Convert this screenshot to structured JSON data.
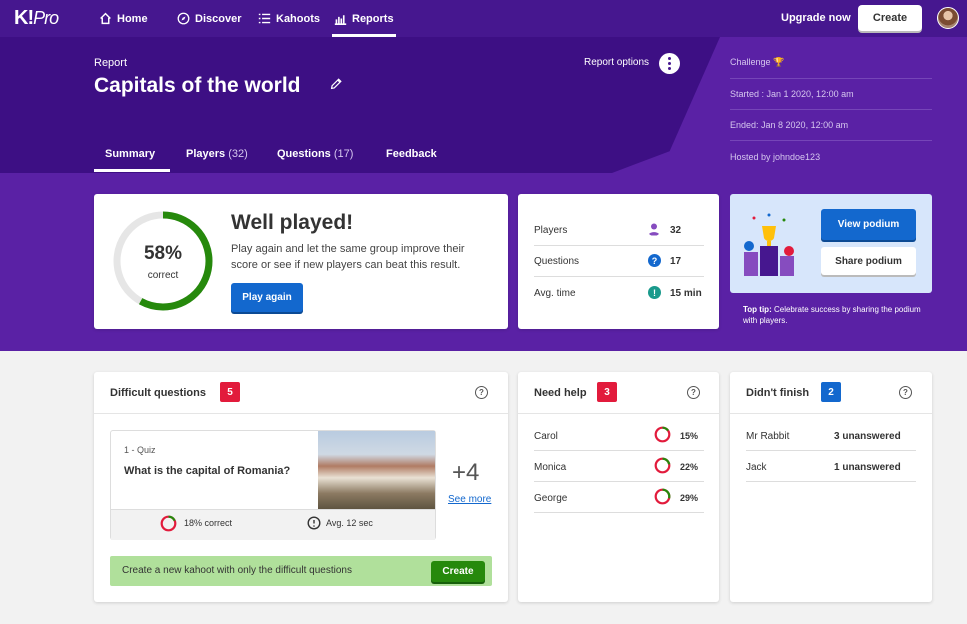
{
  "nav": {
    "logo": "K!",
    "logo_suffix": "Pro",
    "items": [
      {
        "label": "Home",
        "icon": "home-icon"
      },
      {
        "label": "Discover",
        "icon": "compass-icon"
      },
      {
        "label": "Kahoots",
        "icon": "list-icon"
      },
      {
        "label": "Reports",
        "icon": "bar-chart-icon",
        "active": true
      }
    ],
    "upgrade": "Upgrade now",
    "create": "Create"
  },
  "header": {
    "label": "Report",
    "title": "Capitals of the world",
    "options_label": "Report options",
    "tabs": [
      {
        "label": "Summary",
        "count": ""
      },
      {
        "label": "Players",
        "count": "(32)"
      },
      {
        "label": "Questions",
        "count": "(17)"
      },
      {
        "label": "Feedback",
        "count": ""
      }
    ]
  },
  "info": {
    "type": "Challenge",
    "started": "Started : Jan 1 2020, 12:00 am",
    "ended": "Ended: Jan 8 2020, 12:00 am",
    "hosted": "Hosted by johndoe123"
  },
  "summary": {
    "percent": "58%",
    "percent_value": 0.58,
    "percent_label": "correct",
    "title": "Well played!",
    "text": "Play again and let the same group improve their score or see if new players can beat this result.",
    "play_again": "Play again"
  },
  "stats": [
    {
      "label": "Players",
      "value": "32",
      "color": "#864cbf",
      "icon": "user-icon"
    },
    {
      "label": "Questions",
      "value": "17",
      "color": "#1368ce",
      "icon": "question-icon"
    },
    {
      "label": "Avg. time",
      "value": "15 min",
      "color": "#26890c",
      "icon": "clock-icon"
    }
  ],
  "podium": {
    "view": "View podium",
    "share": "Share podium",
    "tip_strong": "Top tip:",
    "tip": "Celebrate success by sharing the podium with players."
  },
  "difficult": {
    "title": "Difficult questions",
    "count": "5",
    "quiz_label": "1 - Quiz",
    "question": "What is the capital of Romania?",
    "more_count": "+4",
    "see_more": "See more",
    "correct": "18% correct",
    "correct_value": 0.18,
    "avg": "Avg. 12 sec",
    "banner": "Create a new kahoot with only the difficult questions",
    "banner_button": "Create"
  },
  "need_help": {
    "title": "Need help",
    "count": "3",
    "people": [
      {
        "name": "Carol",
        "value": "15%",
        "fraction": 0.15
      },
      {
        "name": "Monica",
        "value": "22%",
        "fraction": 0.22
      },
      {
        "name": "George",
        "value": "29%",
        "fraction": 0.29
      }
    ]
  },
  "didnt_finish": {
    "title": "Didn't finish",
    "count": "2",
    "people": [
      {
        "name": "Mr Rabbit",
        "value": "3 unanswered"
      },
      {
        "name": "Jack",
        "value": "1 unanswered"
      }
    ]
  },
  "colors": {
    "brand_purple": "#46178f",
    "hero_purple": "#5a21a5",
    "correct_green": "#26890c",
    "wrong_red": "#e21b3c",
    "blue": "#1368ce"
  }
}
